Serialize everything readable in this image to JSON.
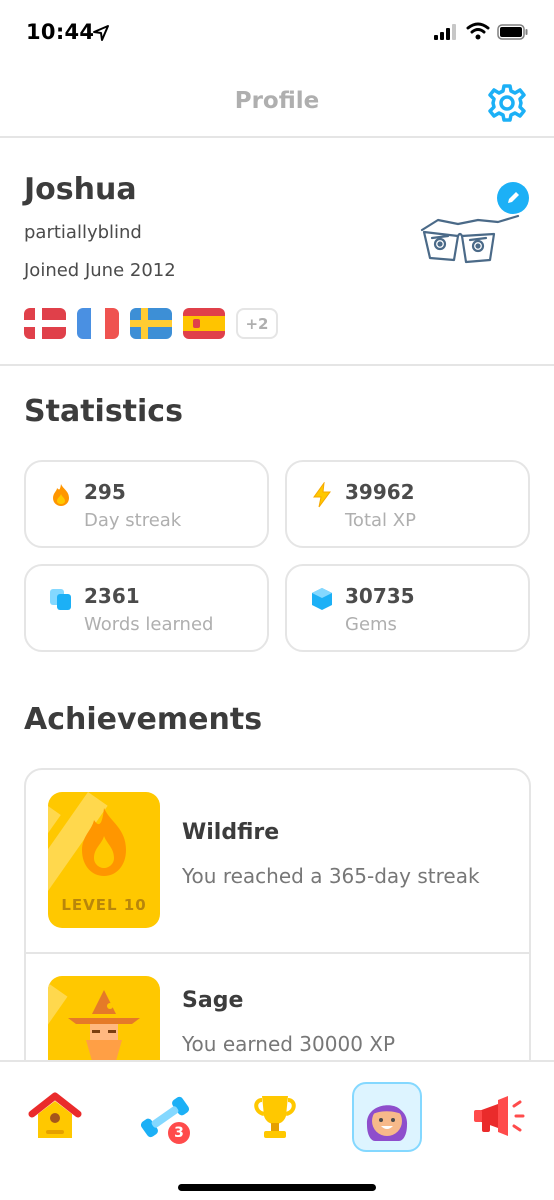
{
  "status_bar": {
    "time": "10:44"
  },
  "header": {
    "title": "Profile",
    "settings_icon": "gear-icon"
  },
  "profile": {
    "name": "Joshua",
    "username": "partiallyblind",
    "joined": "Joined June 2012",
    "flags": [
      "Danish",
      "French",
      "Swedish",
      "Spanish"
    ],
    "extra_courses": "+2"
  },
  "statistics": {
    "title": "Statistics",
    "cards": [
      {
        "icon": "fire-icon",
        "value": "295",
        "label": "Day streak"
      },
      {
        "icon": "lightning-icon",
        "value": "39962",
        "label": "Total XP"
      },
      {
        "icon": "cards-icon",
        "value": "2361",
        "label": "Words learned"
      },
      {
        "icon": "gem-icon",
        "value": "30735",
        "label": "Gems"
      }
    ]
  },
  "achievements": {
    "title": "Achievements",
    "items": [
      {
        "title": "Wildfire",
        "description": "You reached a 365-day streak",
        "badge_text": "LEVEL 10"
      },
      {
        "title": "Sage",
        "description": "You earned 30000 XP"
      }
    ]
  },
  "tab_bar": {
    "tabs": [
      {
        "name": "home",
        "icon": "birdhouse-icon"
      },
      {
        "name": "practice",
        "icon": "dumbbell-icon",
        "badge": "3"
      },
      {
        "name": "leaderboards",
        "icon": "trophy-icon"
      },
      {
        "name": "profile",
        "icon": "avatar-icon"
      },
      {
        "name": "news",
        "icon": "megaphone-icon"
      }
    ]
  },
  "colors": {
    "accent_blue": "#1cb0f6",
    "border_gray": "#e5e5e5",
    "text_dark": "#3c3c3c",
    "text_muted": "#afafaf",
    "badge_gold": "#ffc800",
    "badge_red": "#ff4b4b"
  }
}
